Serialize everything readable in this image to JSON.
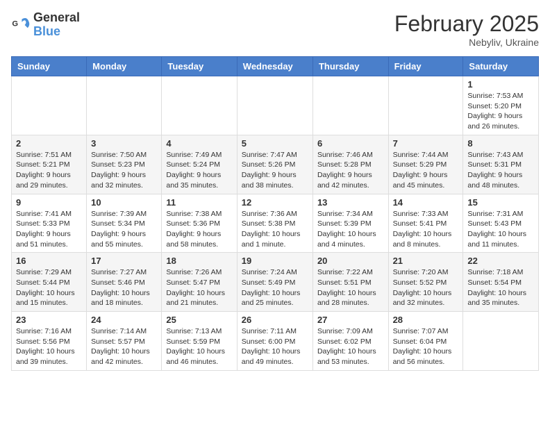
{
  "header": {
    "logo_general": "General",
    "logo_blue": "Blue",
    "month": "February 2025",
    "location": "Nebyliv, Ukraine"
  },
  "weekdays": [
    "Sunday",
    "Monday",
    "Tuesday",
    "Wednesday",
    "Thursday",
    "Friday",
    "Saturday"
  ],
  "weeks": [
    [
      {
        "day": "",
        "info": ""
      },
      {
        "day": "",
        "info": ""
      },
      {
        "day": "",
        "info": ""
      },
      {
        "day": "",
        "info": ""
      },
      {
        "day": "",
        "info": ""
      },
      {
        "day": "",
        "info": ""
      },
      {
        "day": "1",
        "info": "Sunrise: 7:53 AM\nSunset: 5:20 PM\nDaylight: 9 hours and 26 minutes."
      }
    ],
    [
      {
        "day": "2",
        "info": "Sunrise: 7:51 AM\nSunset: 5:21 PM\nDaylight: 9 hours and 29 minutes."
      },
      {
        "day": "3",
        "info": "Sunrise: 7:50 AM\nSunset: 5:23 PM\nDaylight: 9 hours and 32 minutes."
      },
      {
        "day": "4",
        "info": "Sunrise: 7:49 AM\nSunset: 5:24 PM\nDaylight: 9 hours and 35 minutes."
      },
      {
        "day": "5",
        "info": "Sunrise: 7:47 AM\nSunset: 5:26 PM\nDaylight: 9 hours and 38 minutes."
      },
      {
        "day": "6",
        "info": "Sunrise: 7:46 AM\nSunset: 5:28 PM\nDaylight: 9 hours and 42 minutes."
      },
      {
        "day": "7",
        "info": "Sunrise: 7:44 AM\nSunset: 5:29 PM\nDaylight: 9 hours and 45 minutes."
      },
      {
        "day": "8",
        "info": "Sunrise: 7:43 AM\nSunset: 5:31 PM\nDaylight: 9 hours and 48 minutes."
      }
    ],
    [
      {
        "day": "9",
        "info": "Sunrise: 7:41 AM\nSunset: 5:33 PM\nDaylight: 9 hours and 51 minutes."
      },
      {
        "day": "10",
        "info": "Sunrise: 7:39 AM\nSunset: 5:34 PM\nDaylight: 9 hours and 55 minutes."
      },
      {
        "day": "11",
        "info": "Sunrise: 7:38 AM\nSunset: 5:36 PM\nDaylight: 9 hours and 58 minutes."
      },
      {
        "day": "12",
        "info": "Sunrise: 7:36 AM\nSunset: 5:38 PM\nDaylight: 10 hours and 1 minute."
      },
      {
        "day": "13",
        "info": "Sunrise: 7:34 AM\nSunset: 5:39 PM\nDaylight: 10 hours and 4 minutes."
      },
      {
        "day": "14",
        "info": "Sunrise: 7:33 AM\nSunset: 5:41 PM\nDaylight: 10 hours and 8 minutes."
      },
      {
        "day": "15",
        "info": "Sunrise: 7:31 AM\nSunset: 5:43 PM\nDaylight: 10 hours and 11 minutes."
      }
    ],
    [
      {
        "day": "16",
        "info": "Sunrise: 7:29 AM\nSunset: 5:44 PM\nDaylight: 10 hours and 15 minutes."
      },
      {
        "day": "17",
        "info": "Sunrise: 7:27 AM\nSunset: 5:46 PM\nDaylight: 10 hours and 18 minutes."
      },
      {
        "day": "18",
        "info": "Sunrise: 7:26 AM\nSunset: 5:47 PM\nDaylight: 10 hours and 21 minutes."
      },
      {
        "day": "19",
        "info": "Sunrise: 7:24 AM\nSunset: 5:49 PM\nDaylight: 10 hours and 25 minutes."
      },
      {
        "day": "20",
        "info": "Sunrise: 7:22 AM\nSunset: 5:51 PM\nDaylight: 10 hours and 28 minutes."
      },
      {
        "day": "21",
        "info": "Sunrise: 7:20 AM\nSunset: 5:52 PM\nDaylight: 10 hours and 32 minutes."
      },
      {
        "day": "22",
        "info": "Sunrise: 7:18 AM\nSunset: 5:54 PM\nDaylight: 10 hours and 35 minutes."
      }
    ],
    [
      {
        "day": "23",
        "info": "Sunrise: 7:16 AM\nSunset: 5:56 PM\nDaylight: 10 hours and 39 minutes."
      },
      {
        "day": "24",
        "info": "Sunrise: 7:14 AM\nSunset: 5:57 PM\nDaylight: 10 hours and 42 minutes."
      },
      {
        "day": "25",
        "info": "Sunrise: 7:13 AM\nSunset: 5:59 PM\nDaylight: 10 hours and 46 minutes."
      },
      {
        "day": "26",
        "info": "Sunrise: 7:11 AM\nSunset: 6:00 PM\nDaylight: 10 hours and 49 minutes."
      },
      {
        "day": "27",
        "info": "Sunrise: 7:09 AM\nSunset: 6:02 PM\nDaylight: 10 hours and 53 minutes."
      },
      {
        "day": "28",
        "info": "Sunrise: 7:07 AM\nSunset: 6:04 PM\nDaylight: 10 hours and 56 minutes."
      },
      {
        "day": "",
        "info": ""
      }
    ]
  ]
}
